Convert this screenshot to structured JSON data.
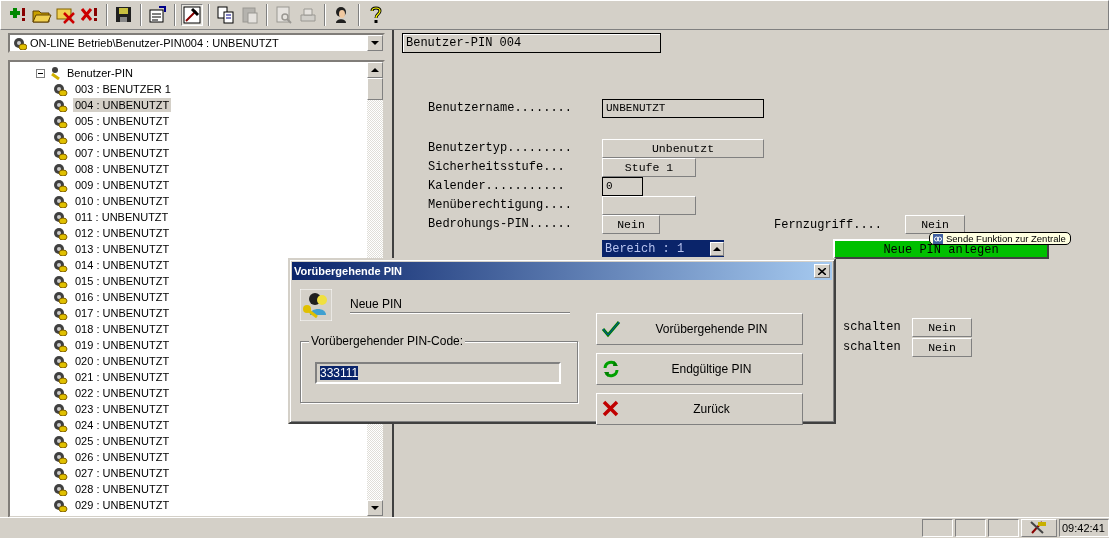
{
  "toolbar": [
    {
      "kind": "add",
      "disabled": false,
      "pressed": false
    },
    {
      "kind": "open",
      "disabled": false,
      "pressed": false
    },
    {
      "kind": "remove",
      "disabled": false,
      "pressed": false
    },
    {
      "kind": "delete",
      "disabled": false,
      "pressed": false
    },
    {
      "kind": "sep"
    },
    {
      "kind": "save",
      "disabled": false,
      "pressed": false
    },
    {
      "kind": "sep"
    },
    {
      "kind": "properties",
      "disabled": false,
      "pressed": false
    },
    {
      "kind": "sep"
    },
    {
      "kind": "tool",
      "disabled": false,
      "pressed": true
    },
    {
      "kind": "sep"
    },
    {
      "kind": "copy",
      "disabled": false,
      "pressed": false
    },
    {
      "kind": "paste",
      "disabled": true,
      "pressed": false
    },
    {
      "kind": "sep"
    },
    {
      "kind": "preview",
      "disabled": true,
      "pressed": false
    },
    {
      "kind": "print",
      "disabled": true,
      "pressed": false
    },
    {
      "kind": "sep"
    },
    {
      "kind": "user",
      "disabled": false,
      "pressed": false
    },
    {
      "kind": "sep"
    },
    {
      "kind": "help",
      "disabled": false,
      "pressed": false
    }
  ],
  "path_combo": {
    "value": "ON-LINE Betrieb\\Benutzer-PIN\\004 : UNBENUTZT"
  },
  "tree": {
    "label": "Benutzer-PIN",
    "expanded": true,
    "children": [
      {
        "label": "003 : BENUTZER 1",
        "selected": false
      },
      {
        "label": "004 : UNBENUTZT",
        "selected": true
      },
      {
        "label": "005 : UNBENUTZT",
        "selected": false
      },
      {
        "label": "006 : UNBENUTZT",
        "selected": false
      },
      {
        "label": "007 : UNBENUTZT",
        "selected": false
      },
      {
        "label": "008 : UNBENUTZT",
        "selected": false
      },
      {
        "label": "009 : UNBENUTZT",
        "selected": false
      },
      {
        "label": "010 : UNBENUTZT",
        "selected": false
      },
      {
        "label": "011 : UNBENUTZT",
        "selected": false
      },
      {
        "label": "012 : UNBENUTZT",
        "selected": false
      },
      {
        "label": "013 : UNBENUTZT",
        "selected": false
      },
      {
        "label": "014 : UNBENUTZT",
        "selected": false
      },
      {
        "label": "015 : UNBENUTZT",
        "selected": false
      },
      {
        "label": "016 : UNBENUTZT",
        "selected": false
      },
      {
        "label": "017 : UNBENUTZT",
        "selected": false
      },
      {
        "label": "018 : UNBENUTZT",
        "selected": false
      },
      {
        "label": "019 : UNBENUTZT",
        "selected": false
      },
      {
        "label": "020 : UNBENUTZT",
        "selected": false
      },
      {
        "label": "021 : UNBENUTZT",
        "selected": false
      },
      {
        "label": "022 : UNBENUTZT",
        "selected": false
      },
      {
        "label": "023 : UNBENUTZT",
        "selected": false
      },
      {
        "label": "024 : UNBENUTZT",
        "selected": false
      },
      {
        "label": "025 : UNBENUTZT",
        "selected": false
      },
      {
        "label": "026 : UNBENUTZT",
        "selected": false
      },
      {
        "label": "027 : UNBENUTZT",
        "selected": false
      },
      {
        "label": "028 : UNBENUTZT",
        "selected": false
      },
      {
        "label": "029 : UNBENUTZT",
        "selected": false
      }
    ]
  },
  "form": {
    "title": "Benutzer-PIN 004",
    "fields": [
      {
        "label": "Benutzername........",
        "value": "UNBENUTZT",
        "kind": "text"
      },
      {
        "label": "Benutzertyp.........",
        "value": "Unbenutzt",
        "kind": "button"
      },
      {
        "label": "Sicherheitsstufe...",
        "value": "Stufe 1",
        "kind": "button"
      },
      {
        "label": "Kalender...........",
        "value": "0",
        "kind": "text"
      },
      {
        "label": "Menüberechtigung....",
        "kind": "button"
      },
      {
        "label": "Bedrohungs-PIN......",
        "value": "Nein",
        "kind": "button"
      }
    ],
    "remote": {
      "label": "Fernzugriff....",
      "value": "Nein"
    },
    "tooltip": "Sende Funktion zur Zentrale",
    "area_spin": {
      "value": "Bereich : 1"
    },
    "new_pin_button": "Neue PIN anlegen",
    "switch_rows": [
      {
        "label": "schalten",
        "value": "Nein"
      },
      {
        "label": "schalten",
        "value": "Nein"
      }
    ]
  },
  "dialog": {
    "title": "Vorübergehende PIN",
    "heading": "Neue PIN",
    "group_label": "Vorübergehender PIN-Code:",
    "pin": {
      "value": "333111",
      "text_selected": true
    },
    "buttons": [
      {
        "kind": "check",
        "label": "Vorübergehende PIN"
      },
      {
        "kind": "refresh",
        "label": "Endgültige PIN"
      },
      {
        "kind": "cancel",
        "label": "Zurück"
      }
    ]
  },
  "status_bar": {
    "time": "09:42:41"
  }
}
